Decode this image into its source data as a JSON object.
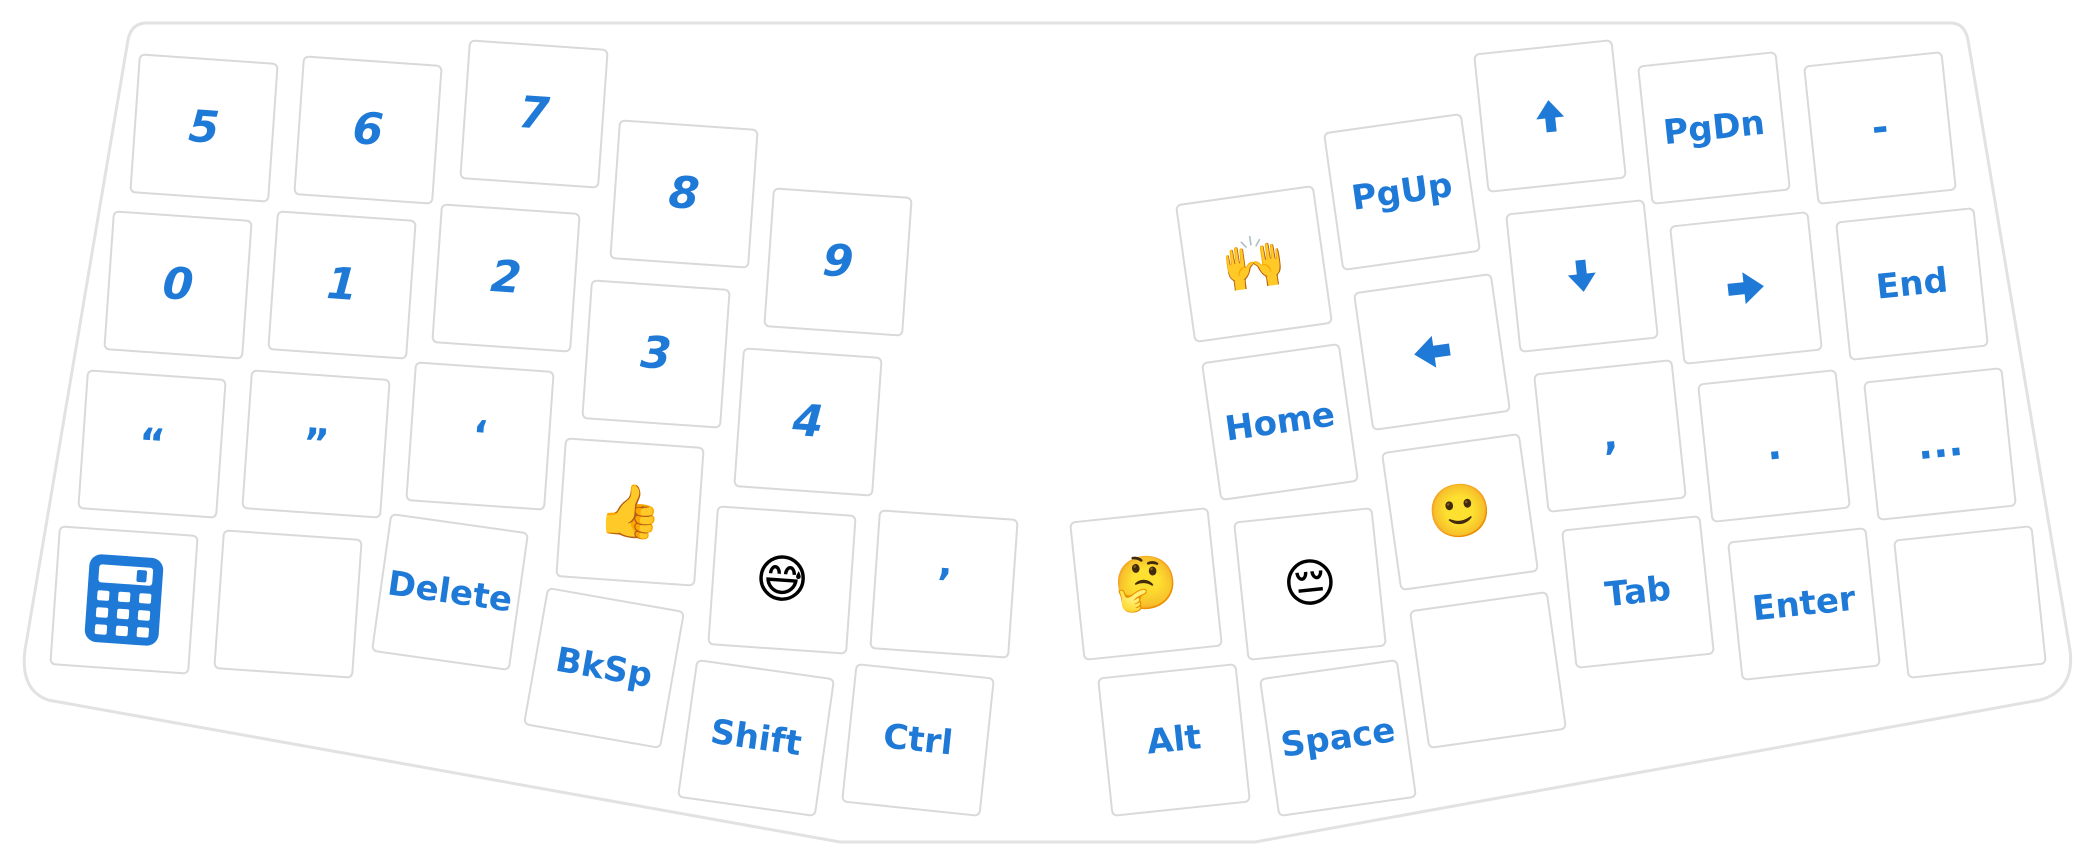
{
  "colors": {
    "accent": "#1e7ad6",
    "key_border": "#d9d9d9",
    "outline": "#e2e2e2"
  },
  "left_half": {
    "row1": [
      "5",
      "6",
      "7",
      "8",
      "9"
    ],
    "row2": [
      "0",
      "1",
      "2",
      "3",
      "4"
    ],
    "row3": [
      "“",
      "”",
      "‘",
      "👍",
      "😅",
      "’"
    ],
    "row4": {
      "icon": "calculator-icon",
      "delete": "Delete",
      "bksp": "BkSp",
      "shift": "Shift",
      "ctrl": "Ctrl"
    }
  },
  "right_half": {
    "row1": {
      "pgup": "PgUp",
      "up": "up-arrow-icon",
      "pgdn": "PgDn",
      "minus": "-"
    },
    "row2": {
      "raise": "🙌",
      "left": "left-arrow-icon",
      "down": "down-arrow-icon",
      "right": "right-arrow-icon",
      "end": "End"
    },
    "row3": {
      "home": "Home",
      "smile": "🙂",
      "comma": ",",
      "period": ".",
      "ellipsis": "..."
    },
    "row4": {
      "think": "🤔",
      "pensive": "😔",
      "tab": "Tab",
      "enter": "Enter"
    },
    "row5": {
      "alt": "Alt",
      "space": "Space"
    }
  }
}
